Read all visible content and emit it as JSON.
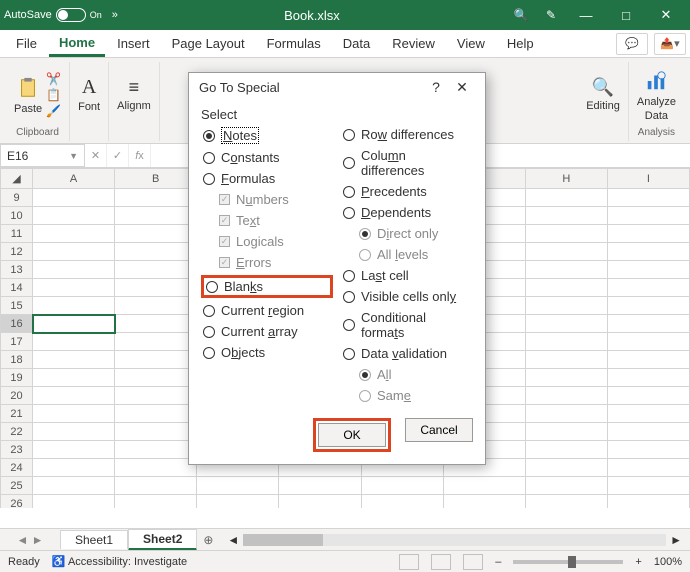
{
  "titlebar": {
    "autosave": "AutoSave",
    "autosave_state": "On",
    "filename": "Book.xlsx"
  },
  "tabs": {
    "file": "File",
    "home": "Home",
    "insert": "Insert",
    "layout": "Page Layout",
    "formulas": "Formulas",
    "data": "Data",
    "review": "Review",
    "view": "View",
    "help": "Help"
  },
  "ribbon": {
    "clipboard": "Clipboard",
    "paste": "Paste",
    "font": "Font",
    "alignment": "Alignm",
    "editing": "Editing",
    "analysis": "Analysis",
    "analyze": "Analyze",
    "analyze2": "Data"
  },
  "namebox": "E16",
  "cols": [
    "A",
    "B",
    "",
    "",
    "",
    "",
    "H",
    "I"
  ],
  "rows": [
    "9",
    "10",
    "11",
    "12",
    "13",
    "14",
    "15",
    "16",
    "17",
    "18",
    "19",
    "20",
    "21",
    "22",
    "23",
    "24",
    "25",
    "26"
  ],
  "sheets": {
    "s1": "Sheet1",
    "s2": "Sheet2"
  },
  "status": {
    "ready": "Ready",
    "access": "Accessibility: Investigate",
    "zoom": "100%"
  },
  "dialog": {
    "title": "Go To Special",
    "select": "Select",
    "left": {
      "notes": "Notes",
      "constants": "Constants",
      "formulas": "Formulas",
      "numbers": "Numbers",
      "text": "Text",
      "logicals": "Logicals",
      "errors": "Errors",
      "blanks": "Blanks",
      "region": "Current region",
      "array": "Current array",
      "objects": "Objects"
    },
    "right": {
      "rowdiff": "Row differences",
      "coldiff": "Column differences",
      "precedents": "Precedents",
      "dependents": "Dependents",
      "direct": "Direct only",
      "alllevels": "All levels",
      "lastcell": "Last cell",
      "visible": "Visible cells only",
      "cond": "Conditional formats",
      "datav": "Data validation",
      "all": "All",
      "same": "Same"
    },
    "ok": "OK",
    "cancel": "Cancel"
  }
}
